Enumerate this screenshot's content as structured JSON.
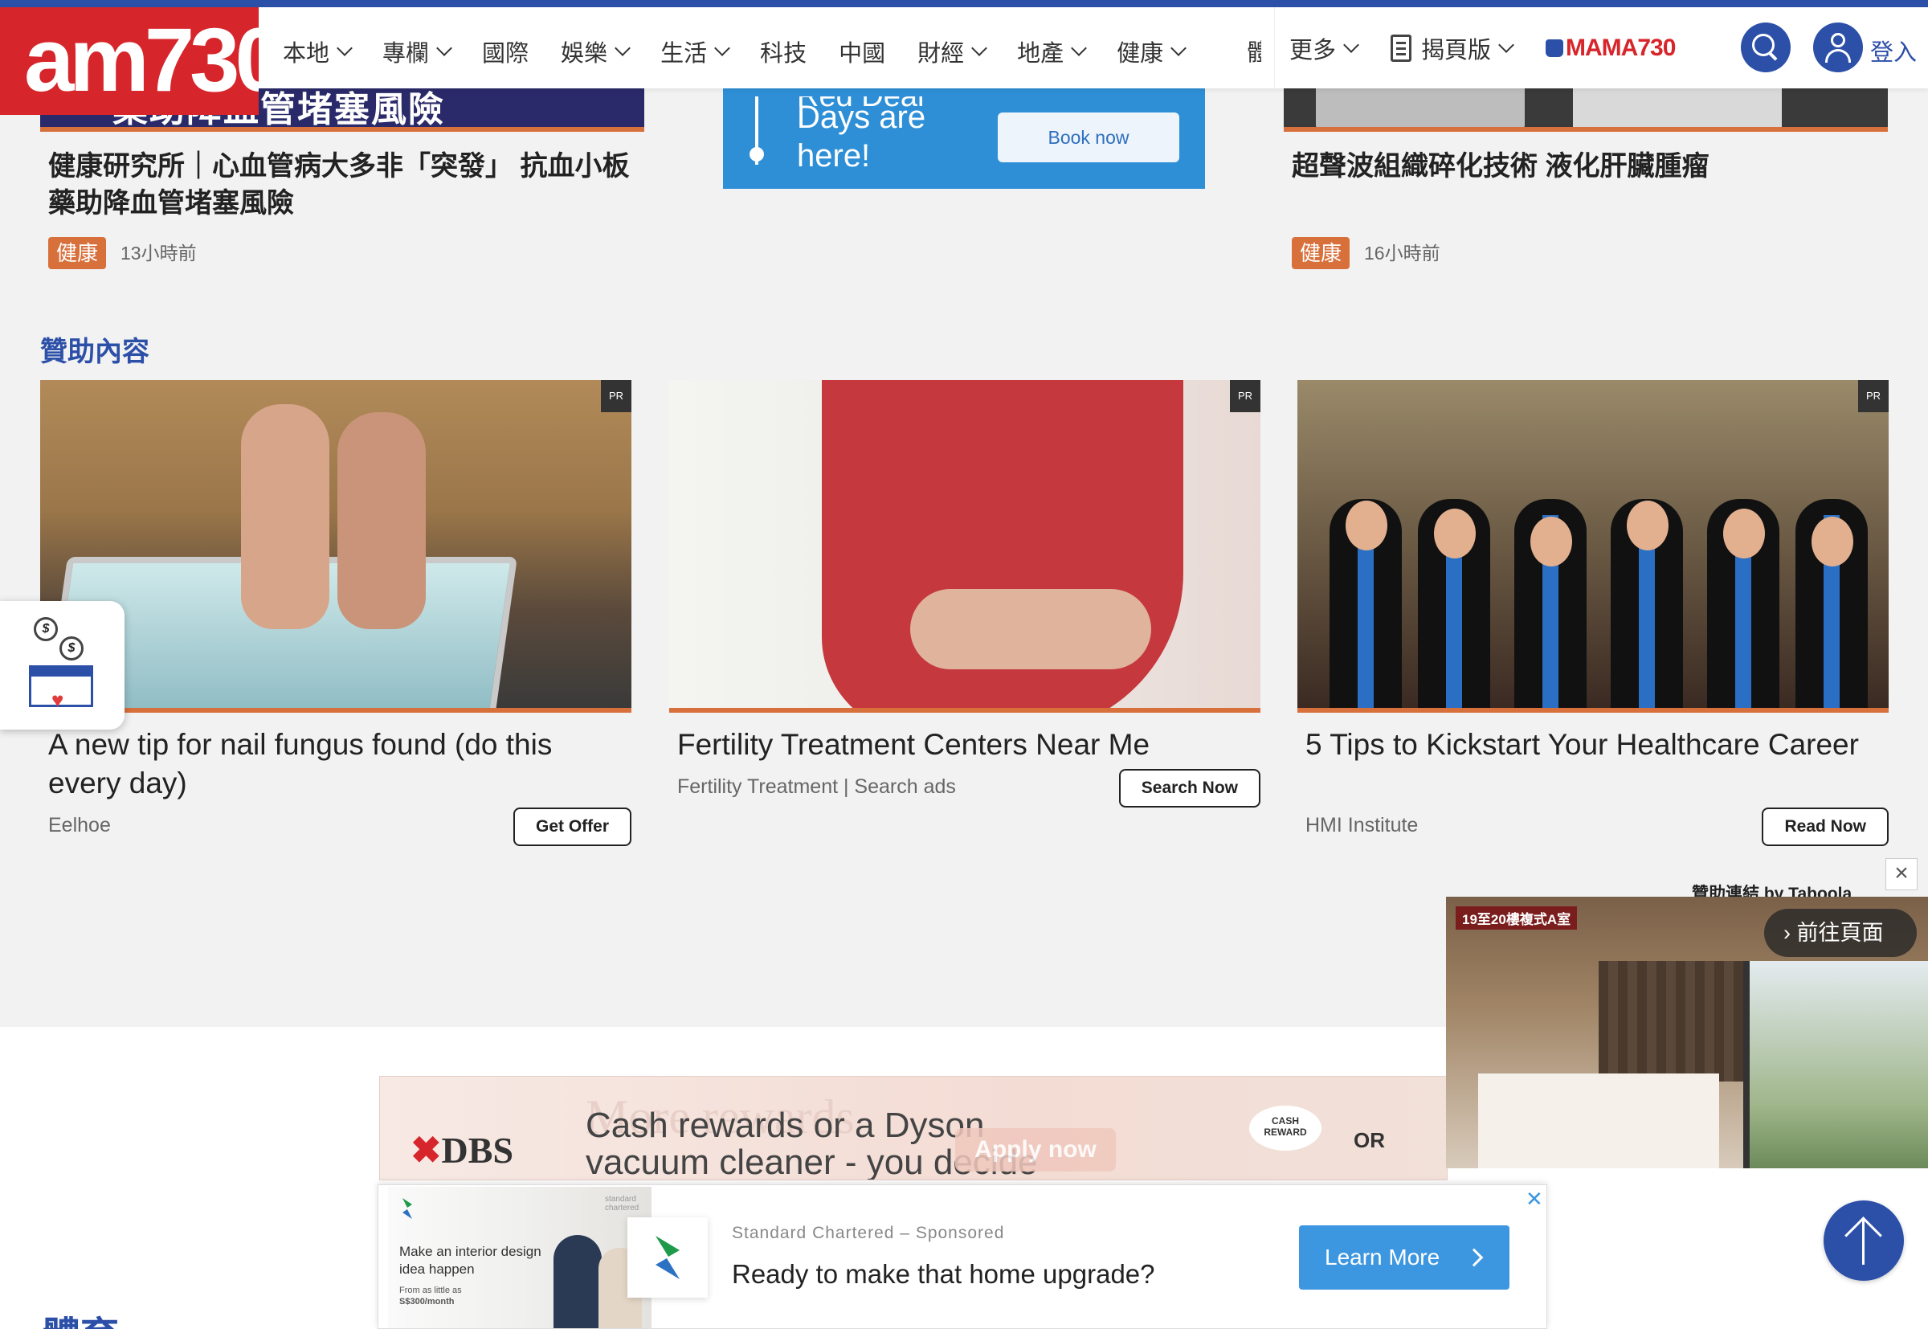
{
  "brand": {
    "logo": "am730"
  },
  "nav": {
    "items": [
      {
        "label": "本地",
        "chevron": true
      },
      {
        "label": "專欄",
        "chevron": true
      },
      {
        "label": "國際",
        "chevron": false
      },
      {
        "label": "娛樂",
        "chevron": true
      },
      {
        "label": "生活",
        "chevron": true
      },
      {
        "label": "科技",
        "chevron": false
      },
      {
        "label": "中國",
        "chevron": false
      },
      {
        "label": "財經",
        "chevron": true
      },
      {
        "label": "地產",
        "chevron": true
      },
      {
        "label": "健康",
        "chevron": true
      }
    ],
    "clipped_item": "體",
    "more": "更多",
    "epaper": "揭頁版",
    "mama": "MAMA730",
    "login": "登入"
  },
  "articles_top": [
    {
      "image_text": "藥助降血管堵塞風險",
      "title_line1": "健康研究所｜心血管病大多非「突發」 抗血小板",
      "title_line2": "藥助降血管堵塞風險",
      "tag": "健康",
      "time": "13小時前"
    },
    {
      "title_line1": "超聲波組織碎化技術 液化肝臟腫瘤",
      "tag": "健康",
      "time": "16小時前"
    }
  ],
  "ad_top": {
    "partial_text": "Red Deal",
    "message_line1": "Days are",
    "message_line2": "here!",
    "button": "Book now"
  },
  "sponsored": {
    "section_title": "贊助內容",
    "badge": "PR",
    "cards": [
      {
        "title": "A new tip for nail fungus found (do this every day)",
        "source": "Eelhoe",
        "cta": "Get Offer"
      },
      {
        "title": "Fertility Treatment Centers Near Me",
        "source": "Fertility Treatment | Search ads",
        "cta": "Search Now"
      },
      {
        "title": "5 Tips to Kickstart Your Healthcare Career",
        "source": "HMI Institute",
        "cta": "Read Now"
      }
    ],
    "attribution": "贊助連結 by Taboola"
  },
  "video_popup": {
    "caption": "19至20樓複式A室",
    "goto": "前往頁面",
    "close": "×"
  },
  "dbs_ad": {
    "logo": "DBS",
    "ghost": "More rewards",
    "line1": "Cash rewards or a Dyson",
    "line2": "vacuum cleaner - you decide",
    "apply": "Apply now",
    "cash_label": "CASH REWARD",
    "or": "OR"
  },
  "sc_ad": {
    "image_text": "Make an interior design idea happen",
    "image_price_line1": "From as little as",
    "image_price_line2": "S$300/month",
    "image_brand": "standard chartered",
    "sponsor_name": "Standard Chartered",
    "sponsor_tag": "Sponsored",
    "headline": "Ready to make that home upgrade?",
    "cta": "Learn More",
    "close": "✕"
  },
  "bottom_section": {
    "title": "體育"
  },
  "colors": {
    "brand_blue": "#2c4fa8",
    "brand_red": "#d7262b",
    "tag_orange": "#d8703c",
    "cta_blue": "#3d97e0"
  }
}
